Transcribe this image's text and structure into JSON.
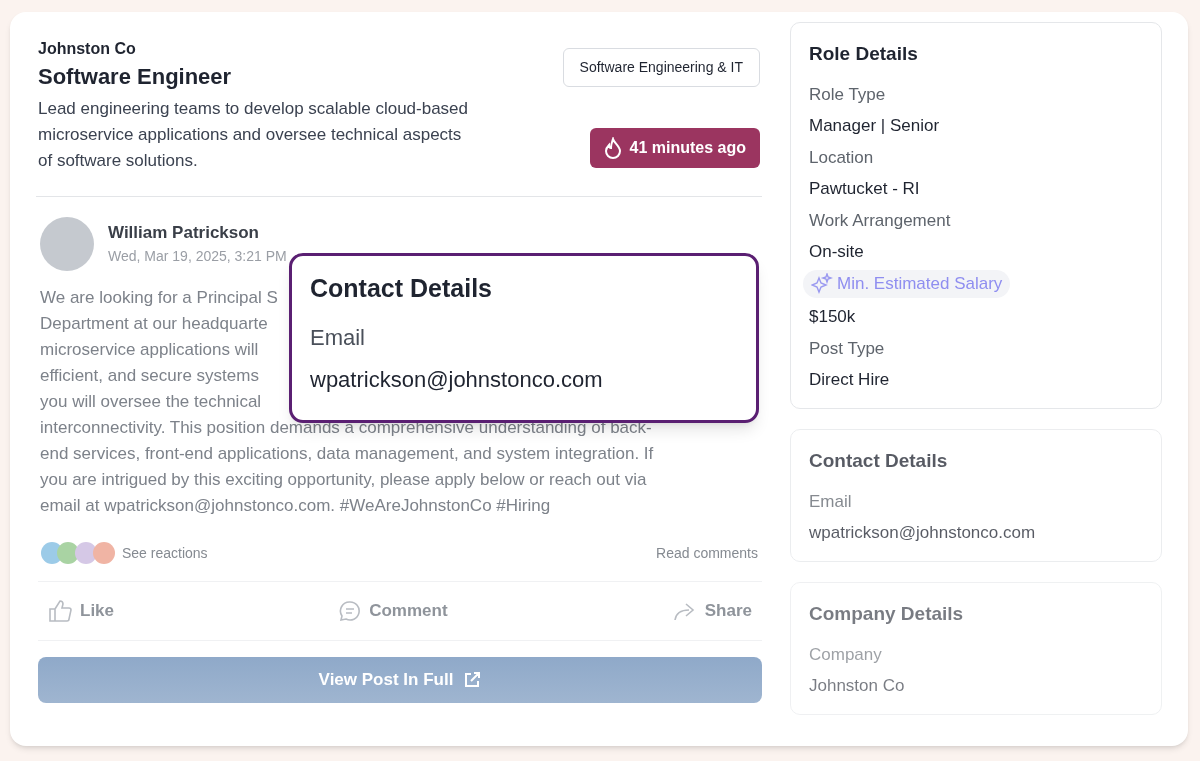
{
  "job": {
    "company": "Johnston Co",
    "title": "Software Engineer",
    "description": "Lead engineering teams to develop scalable cloud-based microservice applications and oversee technical aspects of software solutions.",
    "category": "Software Engineering & IT",
    "posted": "41 minutes ago"
  },
  "post": {
    "author": "William Patrickson",
    "date": "Wed, Mar 19, 2025, 3:21 PM",
    "body_lines": [
      "We are looking for a Principal S",
      "Department at our headquarte",
      "microservice applications will",
      "efficient, and secure systems",
      "you will oversee the technical",
      "interconnectivity. This position demands a comprehensive understanding of back-",
      "end services, front-end applications, data management, and system integration. If",
      "you are intrigued by this exciting opportunity, please apply below or reach out via",
      "email at wpatrickson@johnstonco.com. #WeAreJohnstonCo #Hiring"
    ],
    "reactions_link": "See reactions",
    "comments_link": "Read comments",
    "actions": [
      {
        "kind": "like",
        "label": "Like"
      },
      {
        "kind": "comment",
        "label": "Comment"
      },
      {
        "kind": "share",
        "label": "Share"
      }
    ],
    "view_button": "View Post In Full"
  },
  "popup": {
    "title": "Contact Details",
    "label": "Email",
    "value": "wpatrickson@johnstonco.com"
  },
  "sidebar": {
    "cards": [
      {
        "kind": "normal",
        "title": "Role Details",
        "fields": [
          {
            "kind": "plain",
            "label": "Role Type",
            "value": "Manager | Senior"
          },
          {
            "kind": "plain",
            "label": "Location",
            "value": "Pawtucket - RI"
          },
          {
            "kind": "plain",
            "label": "Work Arrangement",
            "value": "On-site"
          },
          {
            "kind": "highlight",
            "label": "Min. Estimated Salary",
            "value": "$150k"
          },
          {
            "kind": "plain",
            "label": "Post Type",
            "value": "Direct Hire"
          }
        ]
      },
      {
        "kind": "dimmed",
        "title": "Contact Details",
        "fields": [
          {
            "kind": "plain",
            "label": "Email",
            "value": "wpatrickson@johnstonco.com"
          }
        ]
      },
      {
        "kind": "faded",
        "title": "Company Details",
        "fields": [
          {
            "kind": "plain",
            "label": "Company",
            "value": "Johnston Co"
          }
        ]
      }
    ]
  }
}
